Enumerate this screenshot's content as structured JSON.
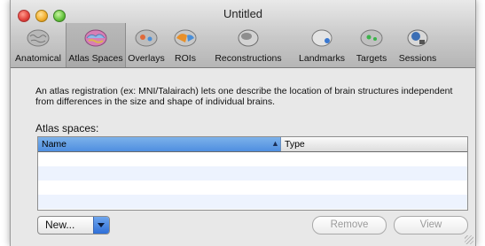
{
  "window": {
    "title": "Untitled"
  },
  "toolbar": {
    "items": [
      {
        "label": "Anatomical",
        "icon": "brain-gray-icon"
      },
      {
        "label": "Atlas Spaces",
        "icon": "brain-atlas-icon",
        "selected": true
      },
      {
        "label": "Overlays",
        "icon": "brain-overlays-icon"
      },
      {
        "label": "ROIs",
        "icon": "brain-rois-icon"
      },
      {
        "label": "Reconstructions",
        "icon": "head-reconstruction-icon"
      },
      {
        "label": "Landmarks",
        "icon": "head-landmarks-icon"
      },
      {
        "label": "Targets",
        "icon": "brain-targets-icon"
      },
      {
        "label": "Sessions",
        "icon": "head-sessions-icon"
      }
    ]
  },
  "description": "An atlas registration (ex: MNI/Talairach) lets one describe the location of brain structures independent from differences in the size and shape of individual brains.",
  "atlas_spaces": {
    "label": "Atlas spaces:",
    "columns": {
      "name": "Name",
      "type": "Type"
    },
    "sort_indicator": "▲",
    "rows": []
  },
  "buttons": {
    "new_label": "New...",
    "remove_label": "Remove",
    "view_label": "View"
  },
  "colors": {
    "selection_blue": "#4f8fe0",
    "disabled_text": "#9b9b9b"
  }
}
